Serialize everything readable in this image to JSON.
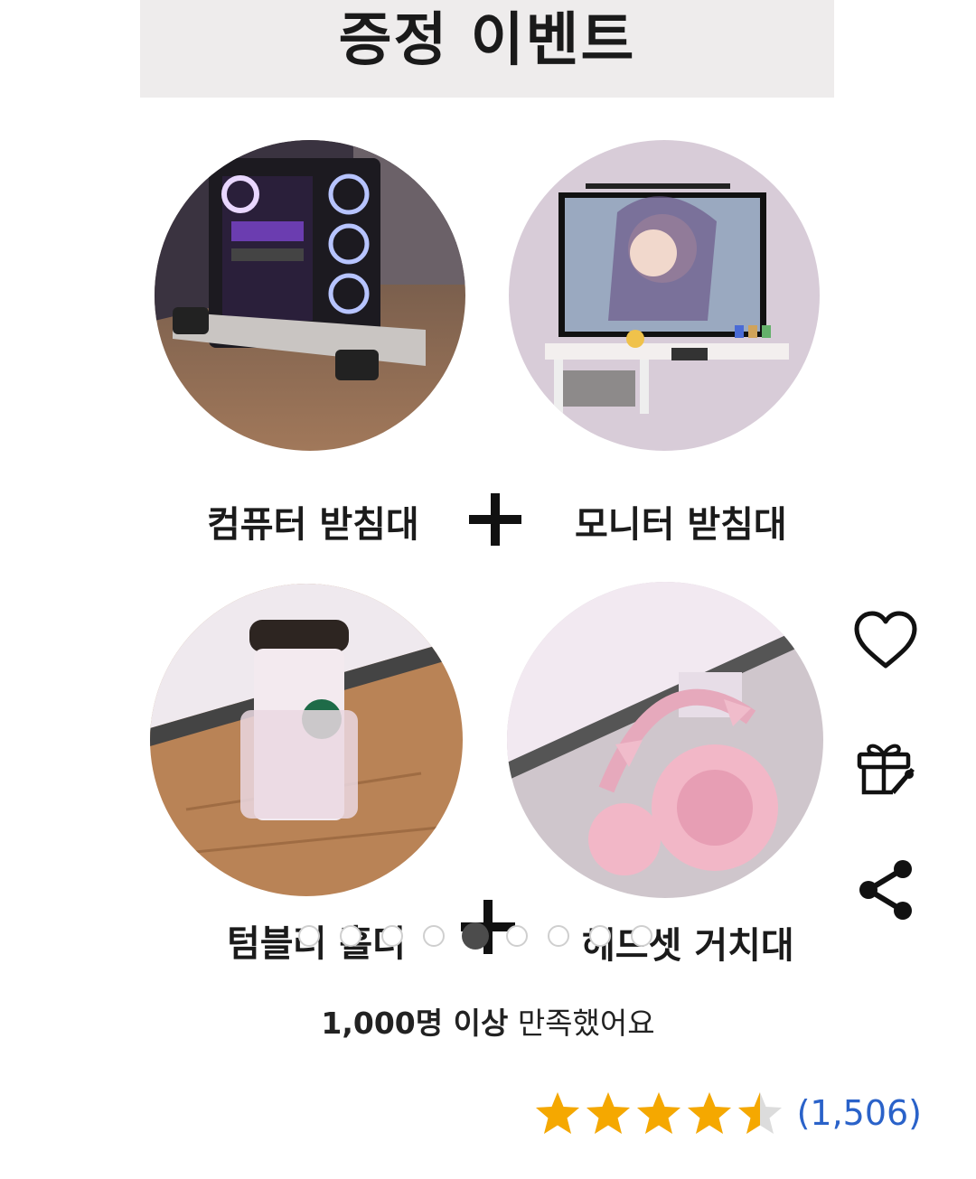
{
  "banner": {
    "title": "증정 이벤트"
  },
  "products": [
    {
      "label": "컴퓨터 받침대",
      "image": "pc-case-stand"
    },
    {
      "label": "모니터 받침대",
      "image": "monitor-stand"
    },
    {
      "label": "텀블러 홀더",
      "image": "tumbler-holder"
    },
    {
      "label": "헤드셋 거치대",
      "image": "headset-hanger"
    }
  ],
  "carousel": {
    "count": 9,
    "active_index": 4
  },
  "satisfaction": {
    "bold": "1,000명 이상",
    "rest": " 만족했어요"
  },
  "rating": {
    "stars": 4.5,
    "count": "(1,506)",
    "star_color": "#f5a800"
  },
  "side_actions": {
    "like_icon": "heart-icon",
    "gift_icon": "gift-icon",
    "share_icon": "share-icon"
  }
}
